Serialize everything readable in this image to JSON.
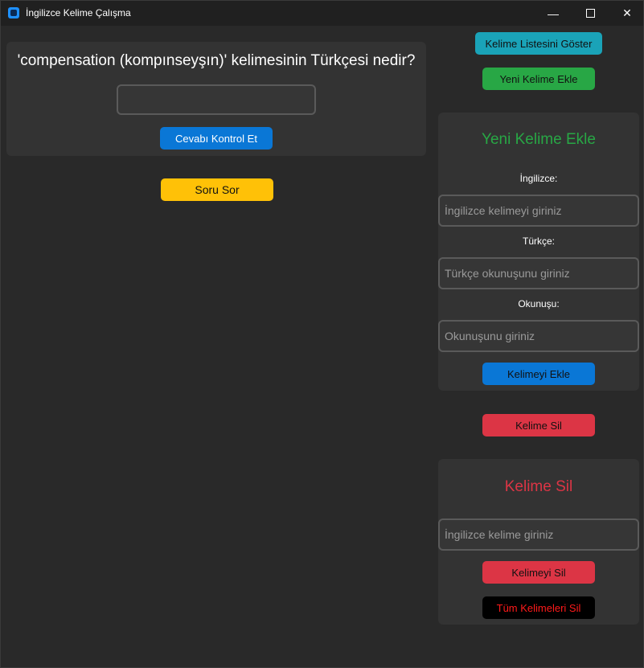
{
  "window": {
    "title": "İngilizce Kelime Çalışma",
    "controls": {
      "minimize": "—",
      "close": "✕"
    }
  },
  "quiz": {
    "question": "'compensation (kompınseyşın)' kelimesinin Türkçesi nedir?",
    "answer_value": "",
    "check_label": "Cevabı Kontrol Et",
    "ask_label": "Soru Sor"
  },
  "side": {
    "show_list_label": "Kelime Listesini Göster",
    "new_word_label": "Yeni Kelime Ekle",
    "delete_word_label": "Kelime Sil"
  },
  "add_panel": {
    "title": "Yeni Kelime Ekle",
    "english_label": "İngilizce:",
    "english_placeholder": "İngilizce kelimeyi giriniz",
    "turkish_label": "Türkçe:",
    "turkish_placeholder": "Türkçe okunuşunu giriniz",
    "pron_label": "Okunuşu:",
    "pron_placeholder": "Okunuşunu giriniz",
    "submit_label": "Kelimeyi Ekle"
  },
  "delete_panel": {
    "title": "Kelime Sil",
    "english_placeholder": "İngilizce kelime giriniz",
    "delete_label": "Kelimeyi Sil",
    "delete_all_label": "Tüm Kelimeleri Sil"
  },
  "colors": {
    "title_add": "#28a745",
    "title_delete": "#dc3545"
  }
}
